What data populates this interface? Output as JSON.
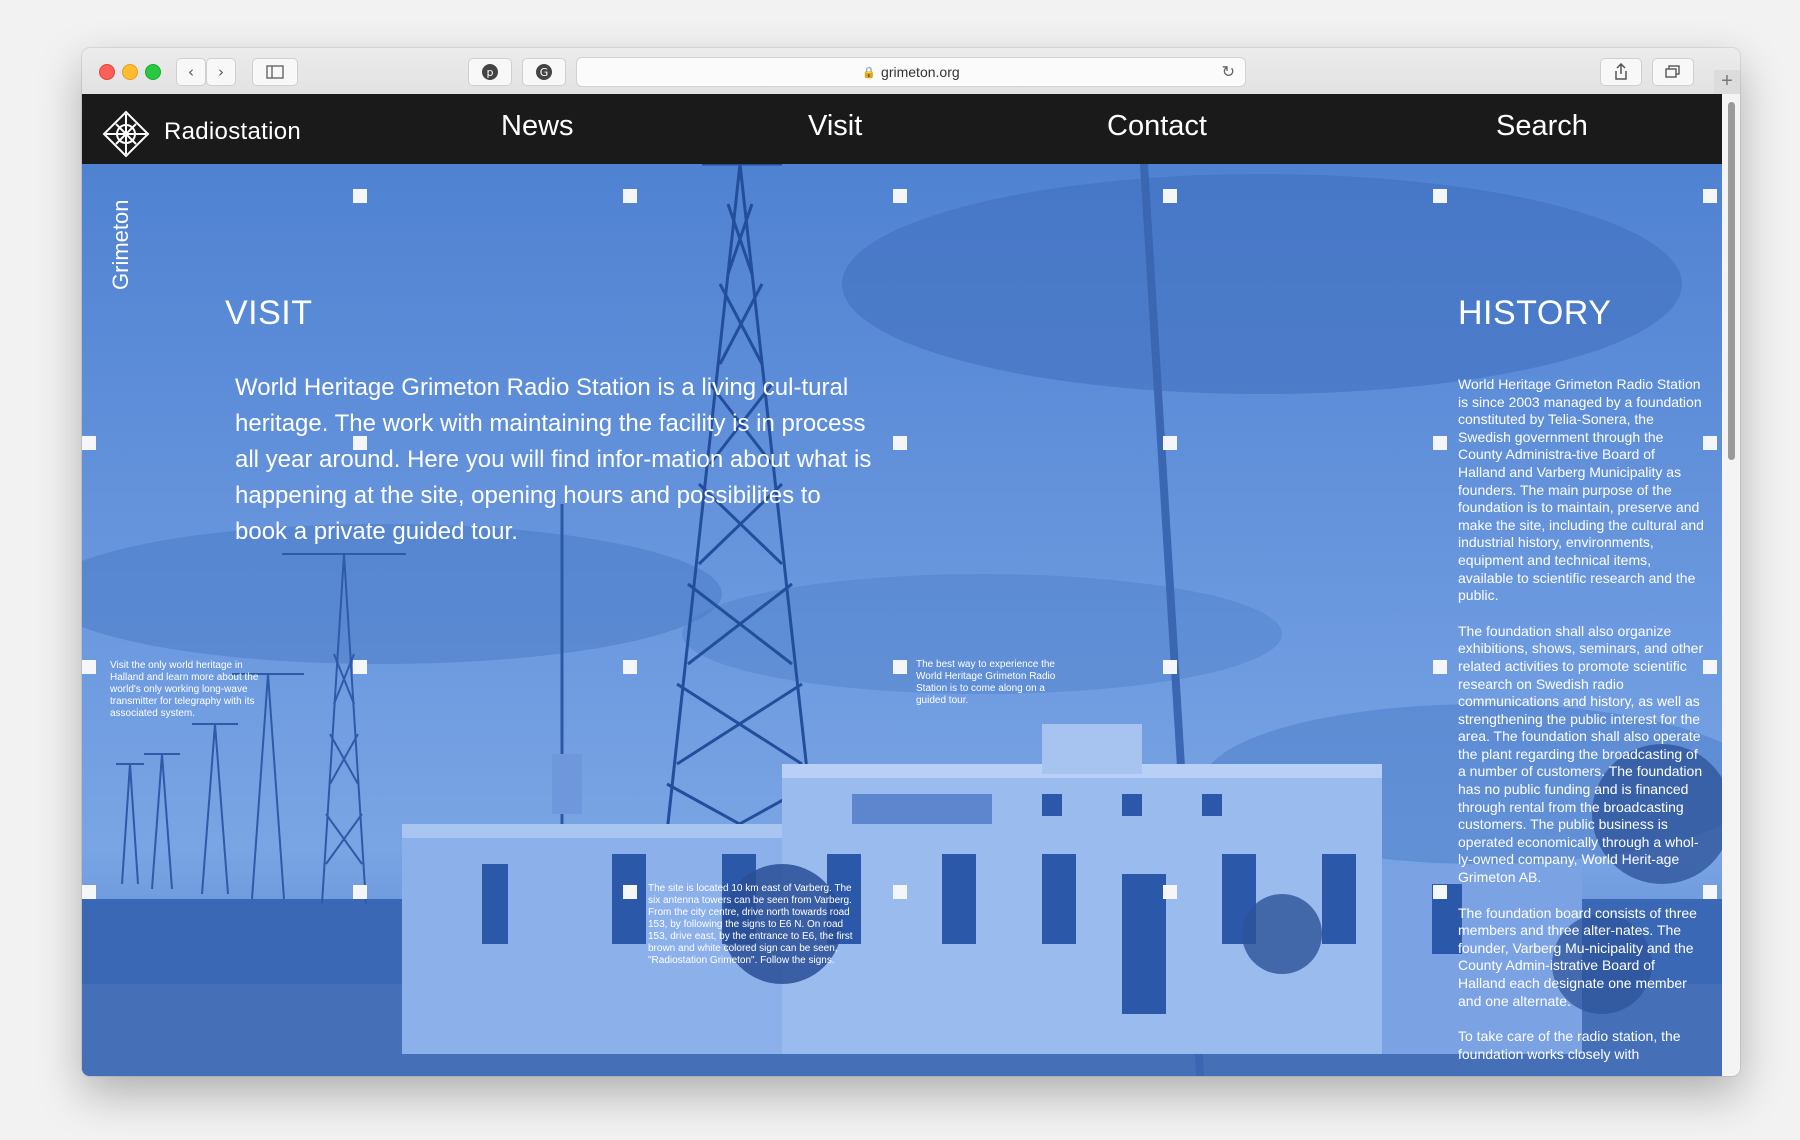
{
  "browser": {
    "url": "grimeton.org",
    "icons": [
      "back-icon",
      "forward-icon",
      "sidebar-icon",
      "pinterest-icon",
      "grammarly-icon",
      "lock-icon",
      "reload-icon",
      "share-icon",
      "tabs-icon",
      "new-tab-icon"
    ]
  },
  "site": {
    "brand": "Radiostation",
    "vertical_label": "Grimeton",
    "nav": [
      "News",
      "Visit",
      "Contact",
      "Search"
    ]
  },
  "visit": {
    "heading": "VISIT",
    "intro": "World Heritage Grimeton Radio Station is a living cul-tural heritage. The work with maintaining the facility is in process all year around. Here you will find infor-mation about what is happening at the site, opening hours and possibilites to book a private guided tour.",
    "notes": [
      "Visit the only world heritage in Halland and learn more about the world's only working long-wave transmitter for telegraphy with its associated system.",
      "The best way to experience the World Heritage Grimeton Radio Station is to come along on a guided tour.",
      "The site is located 10 km east of Varberg. The six antenna towers can be seen from Varberg. From the city centre, drive north towards road 153, by following the signs to E6 N. On road 153, drive east, by the entrance to E6, the first brown and white colored sign can be seen, \"Radiostation Grimeton\". Follow the signs."
    ]
  },
  "history": {
    "heading": "HISTORY",
    "paragraphs": [
      "World Heritage Grimeton Radio Station is since 2003 managed by a foundation constituted by Telia-Sonera, the Swedish government through the County Administra-tive Board of Halland and Varberg Municipality as founders. The main purpose of the foundation is to maintain, preserve and make the site, including the cultural and industrial history, environments, equipment and technical items, available to scientific research and the public.",
      "The foundation shall also organize exhibitions, shows, seminars, and other related activities to promote scientific research on Swedish radio communications and history, as well as strengthening the public interest for the area. The foundation shall also operate the plant regarding the broadcasting of a number of customers. The foundation has no public funding and is financed through rental from the broadcasting customers. The public business is operated economically through a whol-ly-owned company, World Herit-age Grimeton AB.",
      "The foundation board consists of three members and three alter-nates. The founder, Varberg Mu-nicipality and the County Admin-istrative Board of Halland each designate one member and one alternate.",
      "To take care of the radio station, the foundation works closely with"
    ]
  },
  "colors": {
    "nav_bg": "#1a1a1a",
    "overlay_blue": "#5b8bd6",
    "text": "#ffffff"
  }
}
